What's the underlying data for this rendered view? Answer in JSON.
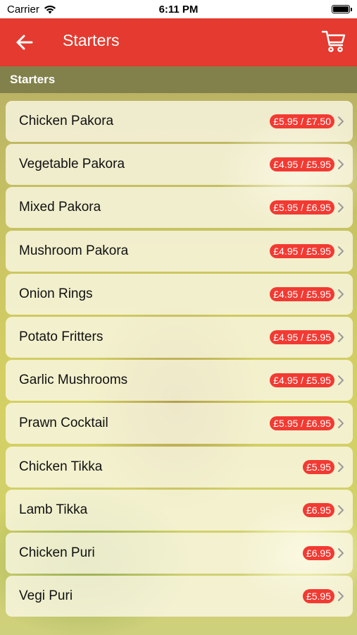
{
  "status_bar": {
    "carrier": "Carrier",
    "time": "6:11 PM"
  },
  "nav": {
    "title": "Starters",
    "back_icon": "arrow-left-icon",
    "cart_icon": "shopping-cart-icon"
  },
  "section": {
    "title": "Starters"
  },
  "items": [
    {
      "name": "Chicken Pakora",
      "price": "£5.95 / £7.50"
    },
    {
      "name": "Vegetable Pakora",
      "price": "£4.95 / £5.95"
    },
    {
      "name": "Mixed Pakora",
      "price": "£5.95 / £6.95"
    },
    {
      "name": "Mushroom Pakora",
      "price": "£4.95 / £5.95"
    },
    {
      "name": "Onion Rings",
      "price": "£4.95 / £5.95"
    },
    {
      "name": "Potato Fritters",
      "price": "£4.95 / £5.95"
    },
    {
      "name": "Garlic Mushrooms",
      "price": "£4.95 / £5.95"
    },
    {
      "name": "Prawn Cocktail",
      "price": "£5.95 / £6.95"
    },
    {
      "name": "Chicken Tikka",
      "price": "£5.95"
    },
    {
      "name": "Lamb Tikka",
      "price": "£6.95"
    },
    {
      "name": "Chicken Puri",
      "price": "£6.95"
    },
    {
      "name": "Vegi Puri",
      "price": "£5.95"
    }
  ],
  "colors": {
    "nav_bg": "#e53a2f",
    "price_badge": "#f23a32"
  }
}
